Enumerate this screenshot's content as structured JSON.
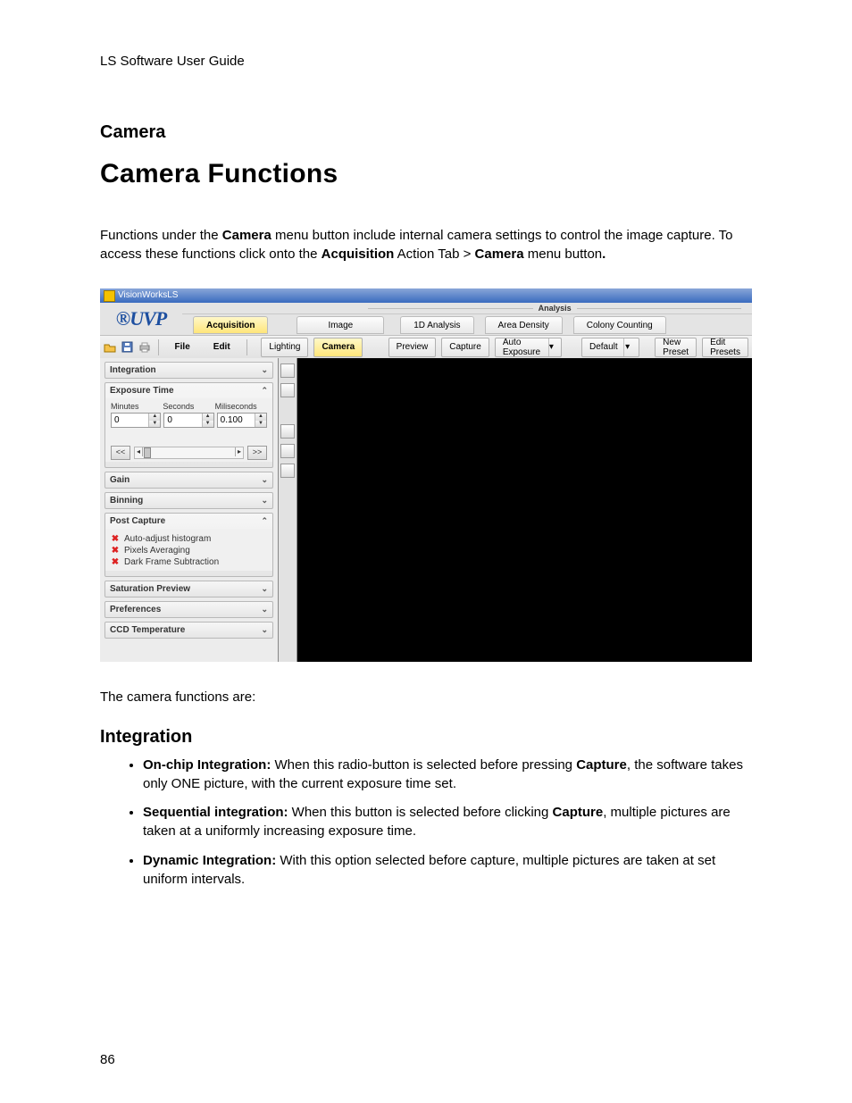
{
  "doc_header": "LS Software User Guide",
  "section": "Camera",
  "title": "Camera Functions",
  "intro_1a": "Functions under the ",
  "intro_1b": "Camera",
  "intro_1c": " menu button include internal camera settings to control the image capture. To access these functions click onto the ",
  "intro_1d": "Acquisition",
  "intro_1e": " Action Tab > ",
  "intro_1f": "Camera",
  "intro_1g": " menu button",
  "intro_1h": ".",
  "after_app": "The camera functions are:",
  "sub1": "Integration",
  "bullets": [
    {
      "b": "On-chip Integration:",
      "t": " When this radio-button is selected before pressing ",
      "b2": "Capture",
      "t2": ", the software takes only ONE picture, with the current exposure time set."
    },
    {
      "b": "Sequential integration:",
      "t": " When this button is selected before clicking ",
      "b2": "Capture",
      "t2": ", multiple pictures are taken at a uniformly increasing exposure time."
    },
    {
      "b": "Dynamic Integration:",
      "t": " With this option selected before capture, multiple pictures are taken at set uniform intervals."
    }
  ],
  "page_num": "86",
  "app": {
    "title": "VisionWorksLS",
    "logo": "UVP",
    "analysis_label": "Analysis",
    "tabs": [
      "Acquisition",
      "Image",
      "1D Analysis",
      "Area Density",
      "Colony Counting"
    ],
    "toolbar_text": {
      "file": "File",
      "edit": "Edit"
    },
    "menu": {
      "lighting": "Lighting",
      "camera": "Camera",
      "preview": "Preview",
      "capture": "Capture",
      "auto_exp": "Auto Exposure",
      "default": "Default",
      "new_preset": "New Preset",
      "edit_presets": "Edit Presets"
    },
    "panels": {
      "integration": "Integration",
      "exposure": "Exposure Time",
      "exp_labels": {
        "min": "Minutes",
        "sec": "Seconds",
        "ms": "Miliseconds"
      },
      "exp_vals": {
        "min": "0",
        "sec": "0",
        "ms": "0.100"
      },
      "gain": "Gain",
      "binning": "Binning",
      "postcap": "Post Capture",
      "pc_items": [
        "Auto-adjust histogram",
        "Pixels Averaging",
        "Dark Frame Subtraction"
      ],
      "satprev": "Saturation Preview",
      "prefs": "Preferences",
      "ccd": "CCD Temperature"
    }
  }
}
